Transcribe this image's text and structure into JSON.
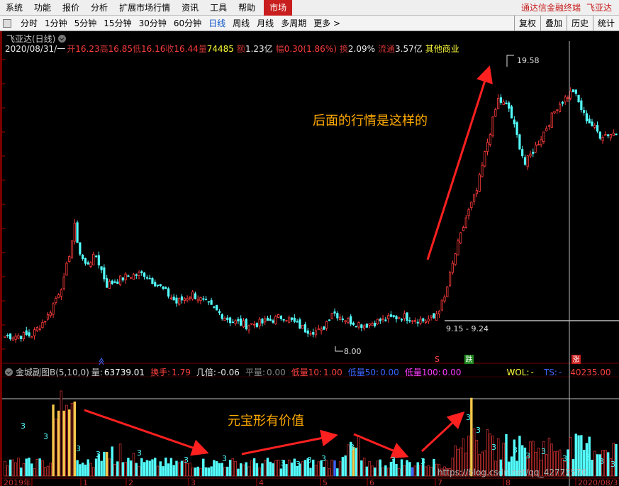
{
  "menu": {
    "items": [
      "系统",
      "功能",
      "报价",
      "分析",
      "扩展市场行情",
      "资讯",
      "工具",
      "帮助"
    ],
    "market": "市场",
    "right": [
      "通达信金融终端",
      "飞亚达"
    ]
  },
  "periodbar": {
    "items": [
      "分时",
      "1分钟",
      "5分钟",
      "15分钟",
      "30分钟",
      "60分钟",
      "日线",
      "周线",
      "月线",
      "多周期",
      "更多 >"
    ],
    "active": "日线",
    "right": [
      "复权",
      "叠加",
      "历史",
      "统计"
    ]
  },
  "quote": {
    "title": "飞亚达(日线)",
    "date": "2020/08/31/一",
    "open_label": "开",
    "open": "16.23",
    "high_label": "高",
    "high": "16.85",
    "low_label": "低",
    "low": "16.16",
    "close_label": "收",
    "close": "16.44",
    "vol_label": "量",
    "vol": "74485",
    "amount_label": "额",
    "amount": "1.23亿",
    "chg_label": "幅",
    "chg": "0.30(1.86%)",
    "turnover_label": "换",
    "turnover": "2.09%",
    "float_label": "流通",
    "float": "3.57亿",
    "sector": "其他商业"
  },
  "indicator": {
    "name": "金城副图B(5,10,0)",
    "vol_label": "量:",
    "vol": "63739.01",
    "hs_label": "换手:",
    "hs": "1.79",
    "jb_label": "几倍:",
    "jb": "-0.06",
    "pl_label": "平量:",
    "pl": "0.00",
    "dl10_label": "低量10:",
    "dl10": "1.00",
    "dl50_label": "低量50:",
    "dl50": "0.00",
    "dl100_label": "低量100:",
    "dl100": "0.00",
    "wol_label": "WOL:",
    "wol": "-",
    "ts_label": "TS:",
    "ts": "-",
    "right_val": "40235.00"
  },
  "annotations": {
    "upper_text": "后面的行情是这样的",
    "lower_text": "元宝形有价值",
    "high_mark": "19.58",
    "low_mark": "8.00",
    "range_mark": "9.15 - 9.24",
    "die_badge": "跌",
    "zhang_badge": "涨",
    "s_badge": "S"
  },
  "xaxis": {
    "labels": [
      "2019年",
      "1",
      "2",
      "3",
      "4",
      "5",
      "6",
      "7",
      "8",
      "2020/08/31/一"
    ]
  },
  "watermark": "https://blog.csdn.net/qq_42772570",
  "colors": {
    "up": "#ff3c3c",
    "down": "#54ffff",
    "accent": "#ffaa00",
    "arrow": "#ff2020"
  }
}
